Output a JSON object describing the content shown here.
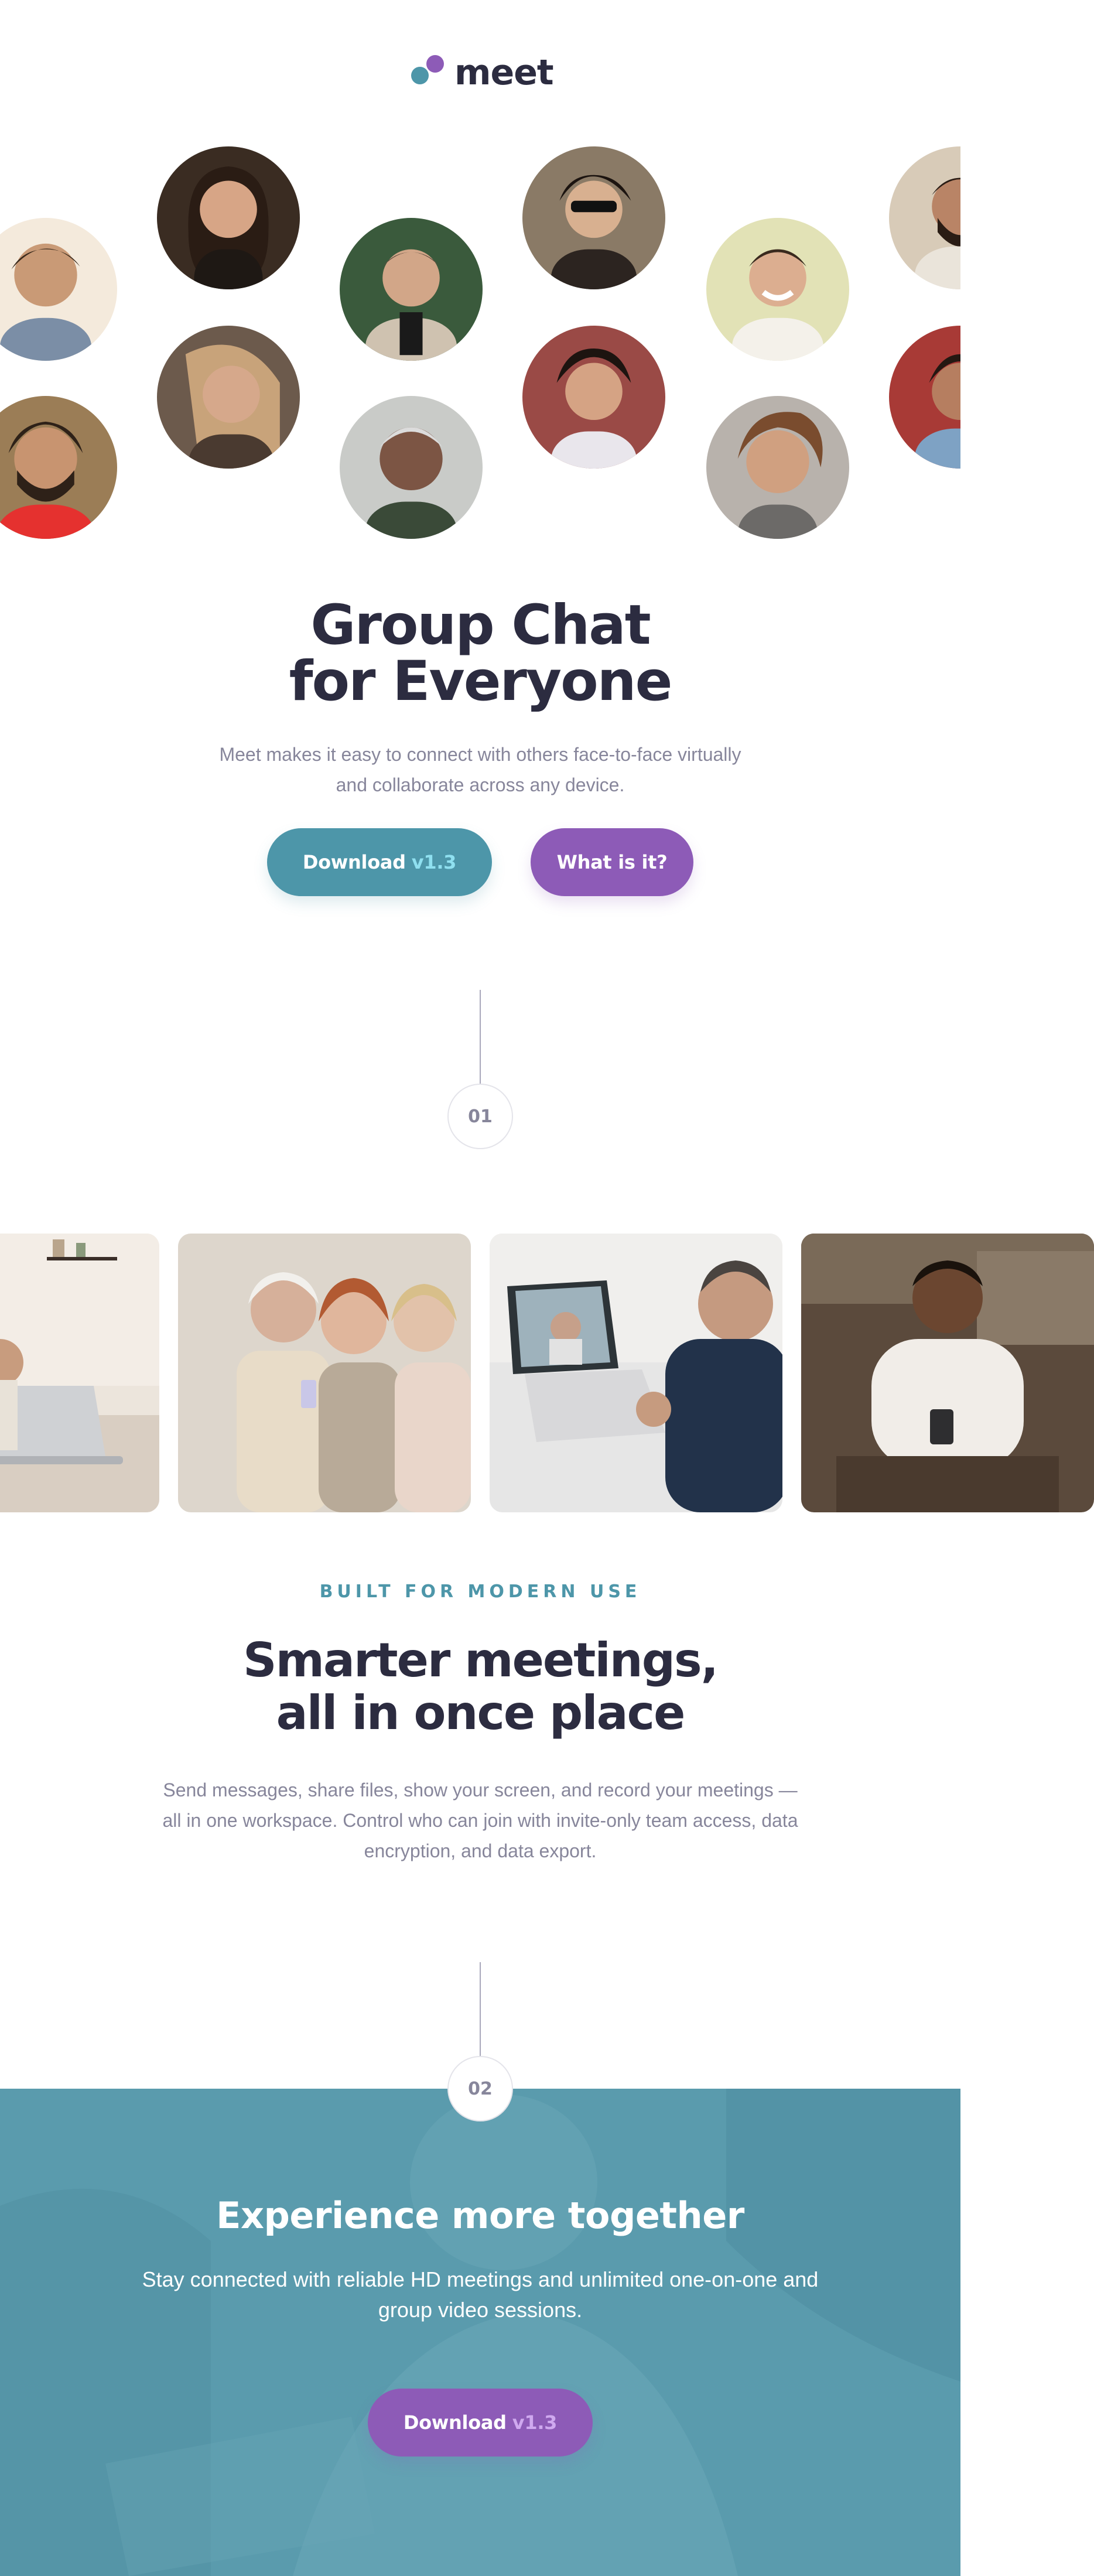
{
  "brand": {
    "name": "meet",
    "colors": {
      "teal": "#4d96a9",
      "purple": "#8d5bb7",
      "dark": "#2c2c40",
      "muted": "#87869b"
    }
  },
  "hero": {
    "title_line1": "Group Chat",
    "title_line2": "for Everyone",
    "subtitle": "Meet makes it easy to connect with others face-to-face virtually and collaborate across any device.",
    "download_label": "Download",
    "download_version": "v1.3",
    "what_label": "What is it?"
  },
  "avatars": [
    "person-avatar",
    "person-avatar",
    "person-avatar",
    "person-avatar",
    "person-avatar",
    "person-avatar",
    "person-avatar",
    "person-avatar",
    "person-avatar",
    "person-avatar",
    "person-avatar",
    "person-avatar"
  ],
  "steps": {
    "first": "01",
    "second": "02"
  },
  "features": {
    "eyebrow": "BUILT FOR MODERN USE",
    "title_line1": "Smarter meetings,",
    "title_line2": "all in once place",
    "body": "Send messages, share files, show your screen, and record your meetings — all in one workspace. Control who can join with invite-only team access, data encryption, and data export."
  },
  "cta": {
    "title": "Experience more together",
    "body": "Stay connected with reliable HD meetings and unlimited one-on-one and group video sessions.",
    "download_label": "Download",
    "download_version": "v1.3"
  }
}
